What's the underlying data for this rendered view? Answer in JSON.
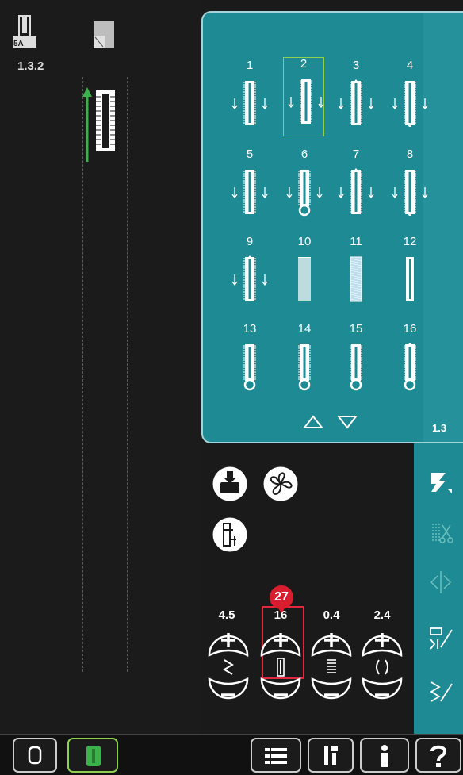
{
  "status": {
    "foot_label": "5A",
    "stitch_code": "1.3.2"
  },
  "stitch_menu": {
    "page_id": "1.3",
    "selected": "2",
    "stitches": [
      {
        "num": "1",
        "type": "arrows"
      },
      {
        "num": "2",
        "type": "arrows"
      },
      {
        "num": "3",
        "type": "arrows-pointed"
      },
      {
        "num": "4",
        "type": "arrows-round"
      },
      {
        "num": "5",
        "type": "arrows"
      },
      {
        "num": "6",
        "type": "arrows-keyhole"
      },
      {
        "num": "7",
        "type": "arrows-pointed"
      },
      {
        "num": "8",
        "type": "arrows-round"
      },
      {
        "num": "9",
        "type": "arrows-pointed"
      },
      {
        "num": "10",
        "type": "dense"
      },
      {
        "num": "11",
        "type": "filled"
      },
      {
        "num": "12",
        "type": "plain"
      },
      {
        "num": "13",
        "type": "keyhole"
      },
      {
        "num": "14",
        "type": "keyhole"
      },
      {
        "num": "15",
        "type": "keyhole"
      },
      {
        "num": "16",
        "type": "keyhole-pointed"
      }
    ]
  },
  "controls": {
    "callout_number": "27",
    "values": [
      {
        "id": "width",
        "value": "4.5",
        "icon": "zigzag-width-icon"
      },
      {
        "id": "length",
        "value": "16",
        "icon": "buttonhole-length-icon"
      },
      {
        "id": "density",
        "value": "0.4",
        "icon": "density-icon"
      },
      {
        "id": "cord",
        "value": "2.4",
        "icon": "cord-spacing-icon"
      }
    ]
  },
  "colors": {
    "panel_teal": "#1e8a94",
    "selection_green": "#8fd14f",
    "callout_red": "#d81e2e",
    "arrow_green": "#3cb34a"
  }
}
